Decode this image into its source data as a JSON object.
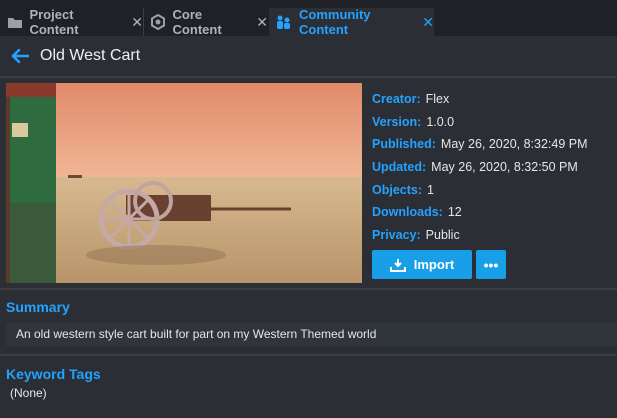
{
  "tabs": [
    {
      "label": "Project Content",
      "icon": "folder-icon",
      "active": false
    },
    {
      "label": "Core Content",
      "icon": "hexagon-icon",
      "active": false
    },
    {
      "label": "Community Content",
      "icon": "people-icon",
      "active": true
    }
  ],
  "header": {
    "title": "Old West Cart",
    "back_icon": "back-arrow-icon"
  },
  "details": [
    {
      "key": "Creator:",
      "value": "Flex"
    },
    {
      "key": "Version:",
      "value": "1.0.0"
    },
    {
      "key": "Published:",
      "value": "May 26, 2020, 8:32:49 PM"
    },
    {
      "key": "Updated:",
      "value": "May 26, 2020, 8:32:50 PM"
    },
    {
      "key": "Objects:",
      "value": "1"
    },
    {
      "key": "Downloads:",
      "value": "12"
    },
    {
      "key": "Privacy:",
      "value": "Public"
    }
  ],
  "actions": {
    "import_label": "Import",
    "more_label": "•••"
  },
  "summary": {
    "title": "Summary",
    "text": "An old western style cart built for part on my Western Themed world"
  },
  "keywords": {
    "title": "Keyword Tags",
    "text": "(None)"
  },
  "colors": {
    "accent": "#23a3ff",
    "button": "#199ee8",
    "background": "#2b2e35"
  }
}
